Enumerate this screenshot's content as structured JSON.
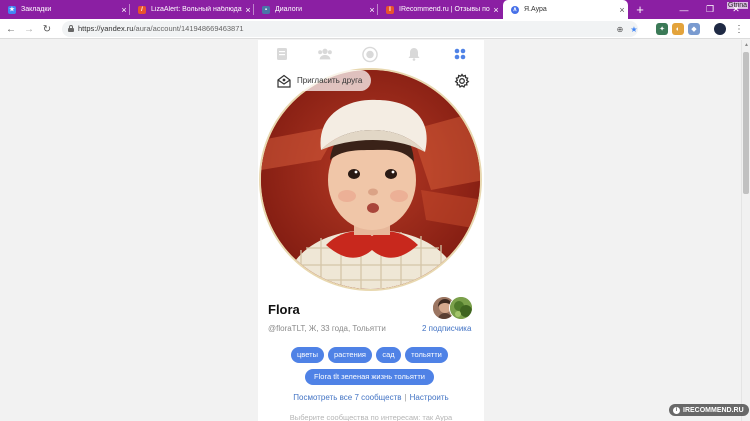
{
  "browser": {
    "tabs": [
      {
        "title": "Закладки",
        "favicon_color": "#4285f4",
        "favicon": "star-icon"
      },
      {
        "title": "LizaAlert: Вольный наблюдатель",
        "favicon_color": "#e8532c",
        "favicon": "lizaalert-icon"
      },
      {
        "title": "Диалоги",
        "favicon_color": "#4a76a8",
        "favicon": "chat-icon"
      },
      {
        "title": "IRecommend.ru | Отзывы пос",
        "favicon_color": "#e8532c",
        "favicon": "irecommend-icon"
      },
      {
        "title": "Я.Аура",
        "favicon_color": "#4670e8",
        "favicon": "aura-icon"
      }
    ],
    "active_tab_index": 4,
    "close_glyph": "×",
    "new_tab_glyph": "+",
    "user_label": "Gtrina",
    "url_host": "https://yandex.ru",
    "url_path": "/aura/account/1419486694638​71",
    "accent_color": "#8b1fa3"
  },
  "profile": {
    "invite_label": "Пригласить друга",
    "name": "Flora",
    "meta": "@floraTLT, Ж, 33 года, Тольятти",
    "subscribers": "2 подписчика",
    "tags_row1": [
      "цветы",
      "растения",
      "сад",
      "тольятти"
    ],
    "tags_row2": [
      "Flora tlt зеленая жизнь тольятти"
    ],
    "see_all": "Посмотреть все 7 сообществ",
    "separator": "|",
    "configure": "Настроить",
    "hint": "Выберите сообщества по интересам: так Аура",
    "tag_color": "#4f82e6"
  },
  "watermark": {
    "text": "IRECOMMEND.RU"
  }
}
